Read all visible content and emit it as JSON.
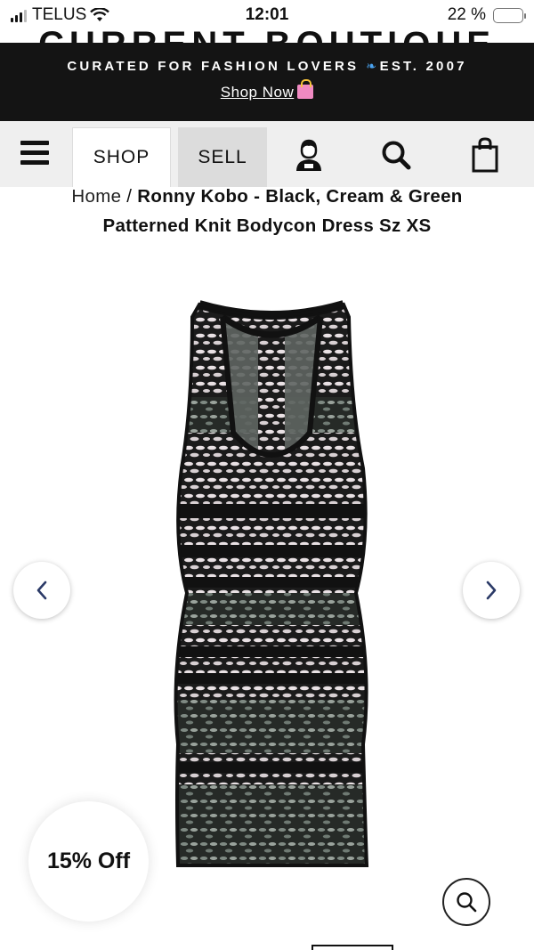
{
  "status_bar": {
    "carrier": "TELUS",
    "time": "12:01",
    "battery_text": "22 %",
    "battery_level": 0.22
  },
  "header": {
    "logo_text": "CURRENT BOUTIQUE"
  },
  "promo": {
    "line": "CURATED FOR FASHION LOVERS",
    "established": "EST. 2007",
    "butterfly_icon": "butterfly-icon",
    "link": "Shop Now",
    "bag_icon": "shopping-bags-icon"
  },
  "nav": {
    "menu_icon": "hamburger-icon",
    "tab_shop": "SHOP",
    "tab_sell": "SELL",
    "account_icon": "account-icon",
    "search_icon": "search-icon",
    "cart_icon": "shopping-bag-icon"
  },
  "breadcrumb": {
    "home": "Home",
    "separator": "/",
    "current": "Ronny Kobo - Black, Cream & Green Patterned Knit Bodycon Dress Sz XS"
  },
  "gallery": {
    "prev_icon": "chevron-left-icon",
    "next_icon": "chevron-right-icon",
    "zoom_icon": "magnifier-icon"
  },
  "discount_badge": "15% Off",
  "colors": {
    "promo_bg": "#141414",
    "nav_bg": "#efefef",
    "arrow_color": "#2b3a67"
  }
}
